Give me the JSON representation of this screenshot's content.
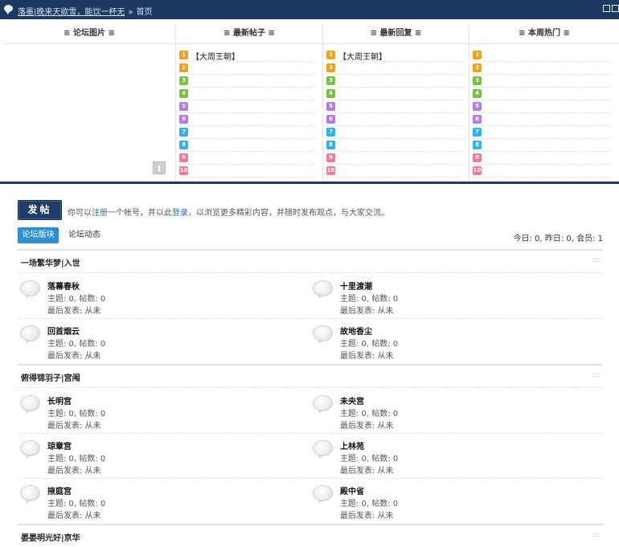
{
  "breadcrumb": {
    "site_name": "落墨|晚来天欲雪，能饮一杯无",
    "separator": "»",
    "current": "首页"
  },
  "portal": {
    "columns": [
      {
        "title": "≡ 论坛图片 ≡"
      },
      {
        "title": "≡ 最新帖子 ≡",
        "items": [
          "【大周王朝】",
          "",
          "",
          "",
          "",
          "",
          "",
          "",
          "",
          ""
        ]
      },
      {
        "title": "≡ 最新回复 ≡",
        "items": [
          "【大周王朝】",
          "",
          "",
          "",
          "",
          "",
          "",
          "",
          "",
          ""
        ]
      },
      {
        "title": "≡ 本周热门 ≡",
        "items": [
          "",
          "",
          "",
          "",
          "",
          "",
          "",
          "",
          "",
          ""
        ]
      }
    ],
    "rank_numbers": [
      "1",
      "2",
      "3",
      "4",
      "5",
      "6",
      "7",
      "8",
      "9",
      "10"
    ]
  },
  "post_bar": {
    "post_button": "发帖",
    "notice_prefix": "你可以",
    "register_link": "注册",
    "notice_middle": "一个帐号，并以此",
    "login_link": "登录",
    "notice_suffix": "，以浏览更多精彩内容，并随时发布观点，与大家交流。"
  },
  "tabs": {
    "active": "论坛版块",
    "other": "论坛动态"
  },
  "stats": "今日: 0, 昨日: 0, 会员: 1",
  "groups": [
    {
      "name": "一场繁华梦|入世",
      "forums": [
        {
          "name": "落幕春秋",
          "stat": "主题: 0, 帖数: 0",
          "last": "最后发表: 从未"
        },
        {
          "name": "十里渡潮",
          "stat": "主题: 0, 帖数: 0",
          "last": "最后发表: 从未"
        },
        {
          "name": "回首烟云",
          "stat": "主题: 0, 帖数: 0",
          "last": "最后发表: 从未"
        },
        {
          "name": "故地香尘",
          "stat": "主题: 0, 帖数: 0",
          "last": "最后发表: 从未"
        }
      ]
    },
    {
      "name": "俯得锦羽子|宫闱",
      "forums": [
        {
          "name": "长明宫",
          "stat": "主题: 0, 帖数: 0",
          "last": "最后发表: 从未"
        },
        {
          "name": "未央宫",
          "stat": "主题: 0, 帖数: 0",
          "last": "最后发表: 从未"
        },
        {
          "name": "琼章宫",
          "stat": "主题: 0, 帖数: 0",
          "last": "最后发表: 从未"
        },
        {
          "name": "上林苑",
          "stat": "主题: 0, 帖数: 0",
          "last": "最后发表: 从未"
        },
        {
          "name": "掖庭宫",
          "stat": "主题: 0, 帖数: 0",
          "last": "最后发表: 从未"
        },
        {
          "name": "殿中省",
          "stat": "主题: 0, 帖数: 0",
          "last": "最后发表: 从未"
        }
      ]
    },
    {
      "name": "晏晏明光好|京华",
      "forums": []
    }
  ]
}
